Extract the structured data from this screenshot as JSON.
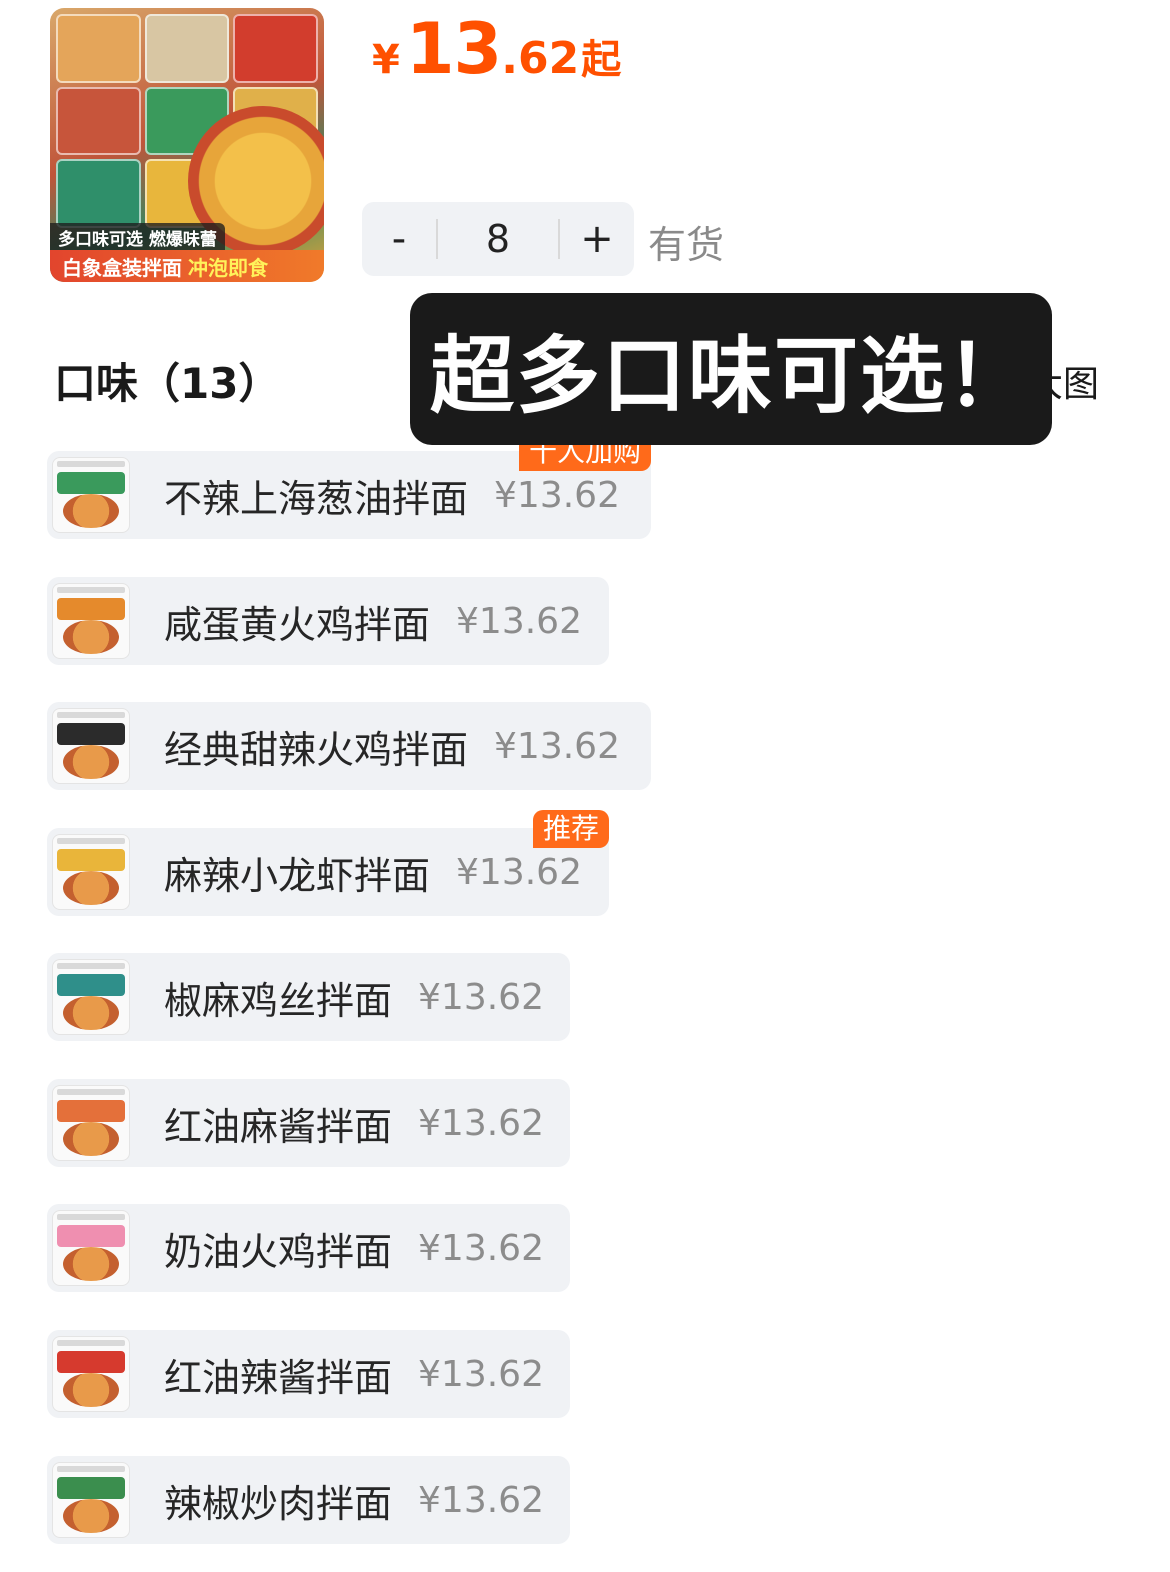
{
  "product": {
    "image_tagline": "多口味可选 燃爆味蕾",
    "image_banner_main": "白象盒装拌面",
    "image_banner_highlight": "冲泡即食"
  },
  "price": {
    "currency": "¥",
    "integer": "13",
    "decimal": ".62",
    "suffix": "起"
  },
  "quantity": {
    "minus": "-",
    "value": "8",
    "plus": "+",
    "stock_status": "有货"
  },
  "section": {
    "title": "口味（13）",
    "view_toggle": "大图"
  },
  "overlay_text": "超多口味可选！",
  "flavors": [
    {
      "name": "不辣上海葱油拌面",
      "price": "¥13.62",
      "badge": "十人加购",
      "lid_color": "#3a9a5c"
    },
    {
      "name": "咸蛋黄火鸡拌面",
      "price": "¥13.62",
      "badge": "",
      "lid_color": "#e58a2c"
    },
    {
      "name": "经典甜辣火鸡拌面",
      "price": "¥13.62",
      "badge": "",
      "lid_color": "#2b2b2b"
    },
    {
      "name": "麻辣小龙虾拌面",
      "price": "¥13.62",
      "badge": "推荐",
      "lid_color": "#e9b53a"
    },
    {
      "name": "椒麻鸡丝拌面",
      "price": "¥13.62",
      "badge": "",
      "lid_color": "#2f8f8a"
    },
    {
      "name": "红油麻酱拌面",
      "price": "¥13.62",
      "badge": "",
      "lid_color": "#e4703a"
    },
    {
      "name": "奶油火鸡拌面",
      "price": "¥13.62",
      "badge": "",
      "lid_color": "#ef8fb0"
    },
    {
      "name": "红油辣酱拌面",
      "price": "¥13.62",
      "badge": "",
      "lid_color": "#d63a2e"
    },
    {
      "name": "辣椒炒肉拌面",
      "price": "¥13.62",
      "badge": "",
      "lid_color": "#3b8e4e"
    }
  ]
}
